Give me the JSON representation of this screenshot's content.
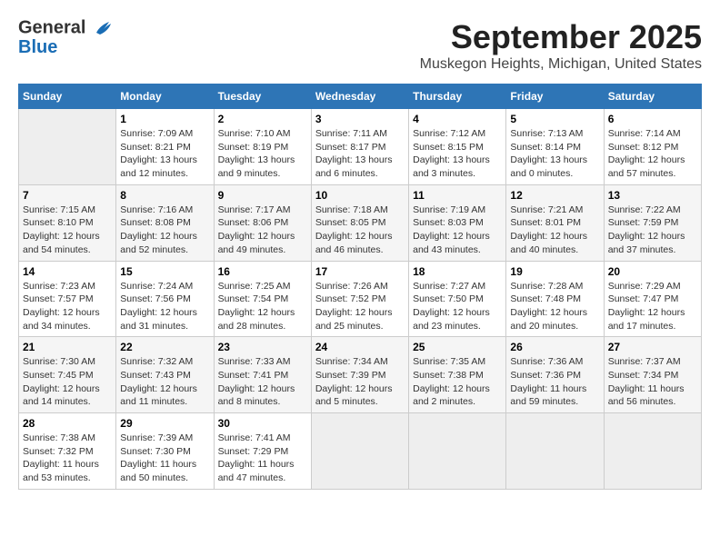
{
  "header": {
    "logo_line1": "General",
    "logo_line2": "Blue",
    "month": "September 2025",
    "location": "Muskegon Heights, Michigan, United States"
  },
  "days_of_week": [
    "Sunday",
    "Monday",
    "Tuesday",
    "Wednesday",
    "Thursday",
    "Friday",
    "Saturday"
  ],
  "weeks": [
    [
      {
        "day": "",
        "sunrise": "",
        "sunset": "",
        "daylight": ""
      },
      {
        "day": "1",
        "sunrise": "Sunrise: 7:09 AM",
        "sunset": "Sunset: 8:21 PM",
        "daylight": "Daylight: 13 hours and 12 minutes."
      },
      {
        "day": "2",
        "sunrise": "Sunrise: 7:10 AM",
        "sunset": "Sunset: 8:19 PM",
        "daylight": "Daylight: 13 hours and 9 minutes."
      },
      {
        "day": "3",
        "sunrise": "Sunrise: 7:11 AM",
        "sunset": "Sunset: 8:17 PM",
        "daylight": "Daylight: 13 hours and 6 minutes."
      },
      {
        "day": "4",
        "sunrise": "Sunrise: 7:12 AM",
        "sunset": "Sunset: 8:15 PM",
        "daylight": "Daylight: 13 hours and 3 minutes."
      },
      {
        "day": "5",
        "sunrise": "Sunrise: 7:13 AM",
        "sunset": "Sunset: 8:14 PM",
        "daylight": "Daylight: 13 hours and 0 minutes."
      },
      {
        "day": "6",
        "sunrise": "Sunrise: 7:14 AM",
        "sunset": "Sunset: 8:12 PM",
        "daylight": "Daylight: 12 hours and 57 minutes."
      }
    ],
    [
      {
        "day": "7",
        "sunrise": "Sunrise: 7:15 AM",
        "sunset": "Sunset: 8:10 PM",
        "daylight": "Daylight: 12 hours and 54 minutes."
      },
      {
        "day": "8",
        "sunrise": "Sunrise: 7:16 AM",
        "sunset": "Sunset: 8:08 PM",
        "daylight": "Daylight: 12 hours and 52 minutes."
      },
      {
        "day": "9",
        "sunrise": "Sunrise: 7:17 AM",
        "sunset": "Sunset: 8:06 PM",
        "daylight": "Daylight: 12 hours and 49 minutes."
      },
      {
        "day": "10",
        "sunrise": "Sunrise: 7:18 AM",
        "sunset": "Sunset: 8:05 PM",
        "daylight": "Daylight: 12 hours and 46 minutes."
      },
      {
        "day": "11",
        "sunrise": "Sunrise: 7:19 AM",
        "sunset": "Sunset: 8:03 PM",
        "daylight": "Daylight: 12 hours and 43 minutes."
      },
      {
        "day": "12",
        "sunrise": "Sunrise: 7:21 AM",
        "sunset": "Sunset: 8:01 PM",
        "daylight": "Daylight: 12 hours and 40 minutes."
      },
      {
        "day": "13",
        "sunrise": "Sunrise: 7:22 AM",
        "sunset": "Sunset: 7:59 PM",
        "daylight": "Daylight: 12 hours and 37 minutes."
      }
    ],
    [
      {
        "day": "14",
        "sunrise": "Sunrise: 7:23 AM",
        "sunset": "Sunset: 7:57 PM",
        "daylight": "Daylight: 12 hours and 34 minutes."
      },
      {
        "day": "15",
        "sunrise": "Sunrise: 7:24 AM",
        "sunset": "Sunset: 7:56 PM",
        "daylight": "Daylight: 12 hours and 31 minutes."
      },
      {
        "day": "16",
        "sunrise": "Sunrise: 7:25 AM",
        "sunset": "Sunset: 7:54 PM",
        "daylight": "Daylight: 12 hours and 28 minutes."
      },
      {
        "day": "17",
        "sunrise": "Sunrise: 7:26 AM",
        "sunset": "Sunset: 7:52 PM",
        "daylight": "Daylight: 12 hours and 25 minutes."
      },
      {
        "day": "18",
        "sunrise": "Sunrise: 7:27 AM",
        "sunset": "Sunset: 7:50 PM",
        "daylight": "Daylight: 12 hours and 23 minutes."
      },
      {
        "day": "19",
        "sunrise": "Sunrise: 7:28 AM",
        "sunset": "Sunset: 7:48 PM",
        "daylight": "Daylight: 12 hours and 20 minutes."
      },
      {
        "day": "20",
        "sunrise": "Sunrise: 7:29 AM",
        "sunset": "Sunset: 7:47 PM",
        "daylight": "Daylight: 12 hours and 17 minutes."
      }
    ],
    [
      {
        "day": "21",
        "sunrise": "Sunrise: 7:30 AM",
        "sunset": "Sunset: 7:45 PM",
        "daylight": "Daylight: 12 hours and 14 minutes."
      },
      {
        "day": "22",
        "sunrise": "Sunrise: 7:32 AM",
        "sunset": "Sunset: 7:43 PM",
        "daylight": "Daylight: 12 hours and 11 minutes."
      },
      {
        "day": "23",
        "sunrise": "Sunrise: 7:33 AM",
        "sunset": "Sunset: 7:41 PM",
        "daylight": "Daylight: 12 hours and 8 minutes."
      },
      {
        "day": "24",
        "sunrise": "Sunrise: 7:34 AM",
        "sunset": "Sunset: 7:39 PM",
        "daylight": "Daylight: 12 hours and 5 minutes."
      },
      {
        "day": "25",
        "sunrise": "Sunrise: 7:35 AM",
        "sunset": "Sunset: 7:38 PM",
        "daylight": "Daylight: 12 hours and 2 minutes."
      },
      {
        "day": "26",
        "sunrise": "Sunrise: 7:36 AM",
        "sunset": "Sunset: 7:36 PM",
        "daylight": "Daylight: 11 hours and 59 minutes."
      },
      {
        "day": "27",
        "sunrise": "Sunrise: 7:37 AM",
        "sunset": "Sunset: 7:34 PM",
        "daylight": "Daylight: 11 hours and 56 minutes."
      }
    ],
    [
      {
        "day": "28",
        "sunrise": "Sunrise: 7:38 AM",
        "sunset": "Sunset: 7:32 PM",
        "daylight": "Daylight: 11 hours and 53 minutes."
      },
      {
        "day": "29",
        "sunrise": "Sunrise: 7:39 AM",
        "sunset": "Sunset: 7:30 PM",
        "daylight": "Daylight: 11 hours and 50 minutes."
      },
      {
        "day": "30",
        "sunrise": "Sunrise: 7:41 AM",
        "sunset": "Sunset: 7:29 PM",
        "daylight": "Daylight: 11 hours and 47 minutes."
      },
      {
        "day": "",
        "sunrise": "",
        "sunset": "",
        "daylight": ""
      },
      {
        "day": "",
        "sunrise": "",
        "sunset": "",
        "daylight": ""
      },
      {
        "day": "",
        "sunrise": "",
        "sunset": "",
        "daylight": ""
      },
      {
        "day": "",
        "sunrise": "",
        "sunset": "",
        "daylight": ""
      }
    ]
  ]
}
